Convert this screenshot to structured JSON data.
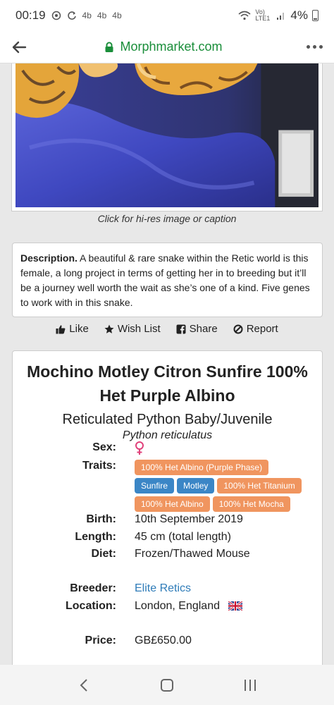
{
  "status_bar": {
    "time": "00:19",
    "left_icons": [
      "whatsapp-icon",
      "sync-icon",
      "4b-icon",
      "4b-icon",
      "4b-icon"
    ],
    "four_b": "4b",
    "network": "Vo) LTE1",
    "battery": "4%"
  },
  "browser": {
    "url": "Morphmarket.com"
  },
  "caption": "Click for hi-res image or caption",
  "description": {
    "label": "Description.",
    "text": " A beautiful & rare snake within the Retic world is this female, a long project in terms of getting her in to breeding but it’ll be a journey well worth the wait as she’s one of a kind. Five genes to work with in this snake."
  },
  "actions": [
    {
      "label": "Like",
      "icon": "thumbs-up-icon"
    },
    {
      "label": "Wish List",
      "icon": "star-icon"
    },
    {
      "label": "Share",
      "icon": "facebook-icon"
    },
    {
      "label": "Report",
      "icon": "ban-icon"
    }
  ],
  "animal": {
    "title": "Mochino Motley Citron Sunfire 100% Het Purple Albino",
    "subtitle": "Reticulated Python Baby/Juvenile",
    "scientific_name": "Python reticulatus",
    "labels": {
      "sex": "Sex:",
      "traits": "Traits:",
      "birth": "Birth:",
      "length": "Length:",
      "diet": "Diet:",
      "breeder": "Breeder:",
      "location": "Location:",
      "price": "Price:"
    },
    "sex_icon": "female-icon",
    "traits": [
      {
        "label": "100% Het Albino (Purple Phase)",
        "color": "#f0955f"
      },
      {
        "label": "Sunfire",
        "color": "#3b86c6"
      },
      {
        "label": "Motley",
        "color": "#3b86c6"
      },
      {
        "label": "100% Het Titanium",
        "color": "#f0955f"
      },
      {
        "label": "100% Het Albino",
        "color": "#f0955f"
      },
      {
        "label": "100% Het Mocha",
        "color": "#f0955f"
      }
    ],
    "birth": "10th September 2019",
    "length": "45 cm (total length)",
    "diet": "Frozen/Thawed Mouse",
    "breeder": "Elite Retics",
    "location": "London, England",
    "location_flag": "uk-flag-icon",
    "price": "GB£650.00"
  },
  "colors": {
    "url_green": "#1a8e3a",
    "trait_orange": "#f0955f",
    "trait_blue": "#3b86c6",
    "link_blue": "#2e7bb8",
    "female_pink": "#e0407a"
  }
}
